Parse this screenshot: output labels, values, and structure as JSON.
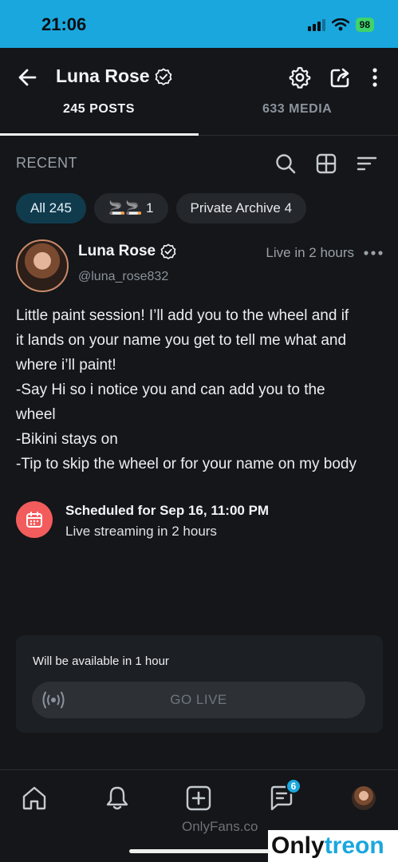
{
  "status_bar": {
    "time": "21:06",
    "battery": "98"
  },
  "app_bar": {
    "title": "Luna Rose"
  },
  "tabs": [
    {
      "label": "245 POSTS"
    },
    {
      "label": "633 MEDIA"
    }
  ],
  "recent": {
    "label": "RECENT"
  },
  "chips": [
    {
      "label": "All 245"
    },
    {
      "label": "🚬🚬 1"
    },
    {
      "label": "Private Archive 4"
    }
  ],
  "post": {
    "author": "Luna Rose",
    "handle": "@luna_rose832",
    "live_in": "Live in 2 hours",
    "lines": [
      "Little paint session! I’ll add you to the wheel and if",
      "it lands on your name you get to tell me what and",
      "where i’ll paint!",
      "-Say Hi so i notice you and can add you to the",
      "wheel",
      "-Bikini stays on",
      "-Tip to skip the wheel or for your name on my body"
    ],
    "scheduled_title": "Scheduled for Sep 16, 11:00 PM",
    "scheduled_sub": "Live streaming in 2 hours",
    "available_text": "Will be available in 1 hour",
    "go_live_label": "GO LIVE"
  },
  "bottom_nav": {
    "messages_badge": "6"
  },
  "watermark": {
    "site": "OnlyFans.co",
    "brand_a": "Only",
    "brand_b": "treon"
  },
  "colors": {
    "accent": "#1aa7dd",
    "calendar": "#f25c5c",
    "background": "#141619"
  },
  "icons": [
    "back-arrow-icon",
    "verified-icon",
    "gear-icon",
    "share-icon",
    "kebab-icon",
    "search-icon",
    "grid-icon",
    "sort-icon",
    "calendar-icon",
    "broadcast-icon",
    "home-icon",
    "bell-icon",
    "add-icon",
    "messages-icon"
  ]
}
